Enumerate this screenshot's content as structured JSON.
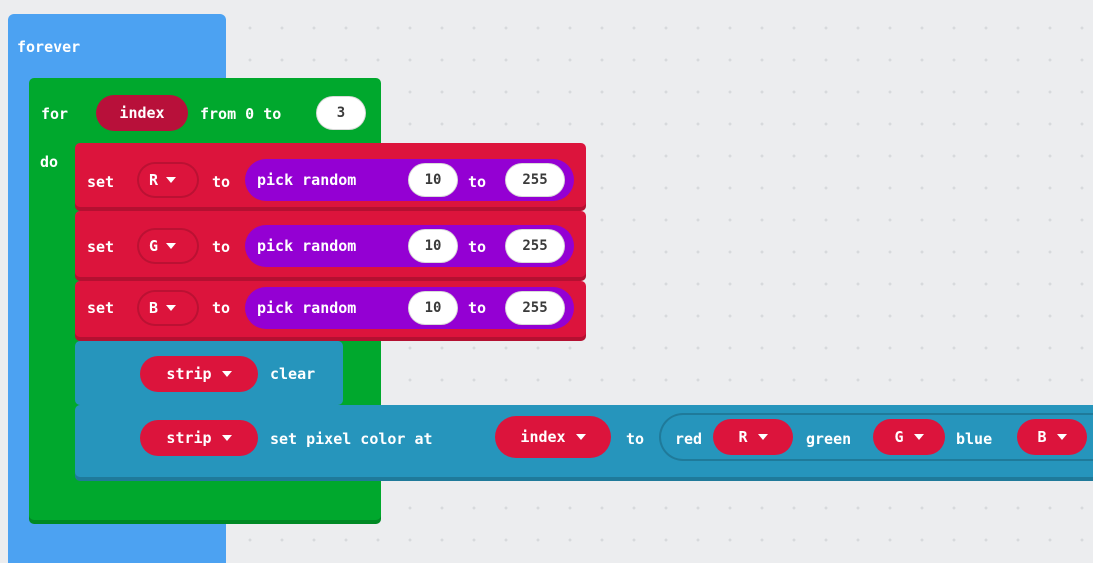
{
  "colors": {
    "loops_blue": "#4ca2f2",
    "loops_green": "#00a82d",
    "variables_red": "#dc143c",
    "math_purple": "#9400d3",
    "neopixel_teal": "#2695bc"
  },
  "forever": {
    "label": "forever"
  },
  "for_loop": {
    "for_label": "for",
    "variable": "index",
    "from_label": "from 0 to",
    "end_value": "3",
    "do_label": "do"
  },
  "set_blocks": [
    {
      "set_label": "set",
      "variable": "R",
      "to_label": "to",
      "func": "pick random",
      "min": "10",
      "mid_label": "to",
      "max": "255"
    },
    {
      "set_label": "set",
      "variable": "G",
      "to_label": "to",
      "func": "pick random",
      "min": "10",
      "mid_label": "to",
      "max": "255"
    },
    {
      "set_label": "set",
      "variable": "B",
      "to_label": "to",
      "func": "pick random",
      "min": "10",
      "mid_label": "to",
      "max": "255"
    }
  ],
  "strip_clear": {
    "strip": "strip",
    "action": "clear"
  },
  "strip_set_pixel": {
    "strip": "strip",
    "action": "set pixel color at",
    "index_var": "index",
    "to_label": "to",
    "red_label": "red",
    "red_var": "R",
    "green_label": "green",
    "green_var": "G",
    "blue_label": "blue",
    "blue_var": "B"
  }
}
